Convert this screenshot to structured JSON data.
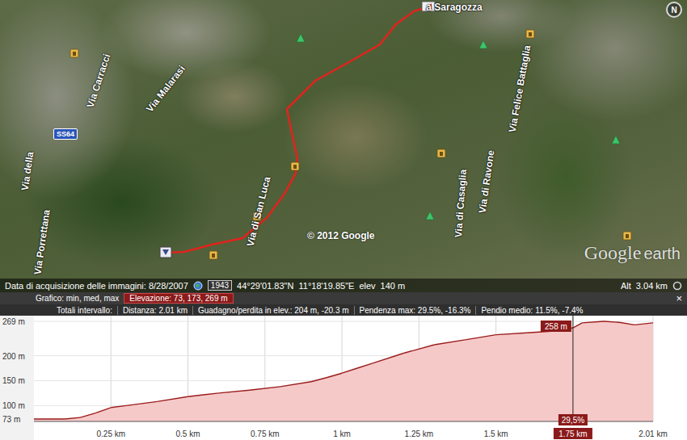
{
  "map": {
    "labels": [
      {
        "text": "Via della"
      },
      {
        "text": "Via Porrettana"
      },
      {
        "text": "Via Carracci"
      },
      {
        "text": "Via Malarasi"
      },
      {
        "text": "Via di San Luca"
      },
      {
        "text": "Via di Casaglia"
      },
      {
        "text": "Via di Ravone"
      },
      {
        "text": "Via Felice Battaglia"
      },
      {
        "text": "a Saragozza"
      }
    ],
    "road_shield": "SS64",
    "copyright": "© 2012 Google",
    "logo": {
      "brand": "Google",
      "product": "earth"
    },
    "compass": "N"
  },
  "status_bar": {
    "imagery_date": "Data di acquisizione delle immagini: 8/28/2007",
    "historical_year": "1943",
    "latitude": "44°29'01.83\"N",
    "longitude": "11°18'19.85\"E",
    "elevation_label": "elev",
    "elevation": "140 m",
    "altitude_label": "Alt",
    "altitude": "3.04 km"
  },
  "profile": {
    "chart_label": "Grafico: min, med, max",
    "elevation_summary": "Elevazione: 73, 173, 269 m",
    "close": "×",
    "totals_label": "Totali intervallo:",
    "stats": [
      "Distanza: 2.01 km",
      "Guadagno/perdita in elev.: 204 m, -20.3 m",
      "Pendenza max: 29.5%, -16.3%",
      "Pendio medio: 11.5%, -7.4%"
    ],
    "y_ticks": [
      {
        "label": "269 m",
        "value": 269
      },
      {
        "label": "200 m",
        "value": 200
      },
      {
        "label": "150 m",
        "value": 150
      },
      {
        "label": "100 m",
        "value": 100
      },
      {
        "label": "73 m",
        "value": 73
      }
    ],
    "x_ticks": [
      {
        "label": "0.25 km",
        "km": 0.25,
        "selected": false
      },
      {
        "label": "0.5 km",
        "km": 0.5,
        "selected": false
      },
      {
        "label": "0.75 km",
        "km": 0.75,
        "selected": false
      },
      {
        "label": "1 km",
        "km": 1,
        "selected": false
      },
      {
        "label": "1.25 km",
        "km": 1.25,
        "selected": false
      },
      {
        "label": "1.5 km",
        "km": 1.5,
        "selected": false
      },
      {
        "label": "1.75 km",
        "km": 1.75,
        "selected": true
      },
      {
        "label": "2.01 km",
        "km": 2.01,
        "selected": false
      }
    ],
    "series": {
      "name": "Elevazione",
      "distances_km": [
        0,
        0.1,
        0.15,
        0.2,
        0.25,
        0.3,
        0.4,
        0.5,
        0.6,
        0.7,
        0.8,
        0.9,
        0.95,
        1.0,
        1.05,
        1.1,
        1.2,
        1.3,
        1.4,
        1.5,
        1.6,
        1.7,
        1.75,
        1.78,
        1.85,
        1.9,
        1.95,
        2.01
      ],
      "values": [
        73,
        73,
        76,
        85,
        96,
        100,
        108,
        118,
        125,
        131,
        138,
        148,
        156,
        165,
        175,
        185,
        205,
        222,
        232,
        242,
        246,
        250,
        256,
        266,
        269,
        267,
        262,
        266
      ]
    },
    "marker": {
      "km": 1.75,
      "elevation_label": "258 m",
      "slope_label": "29,5%"
    }
  }
}
